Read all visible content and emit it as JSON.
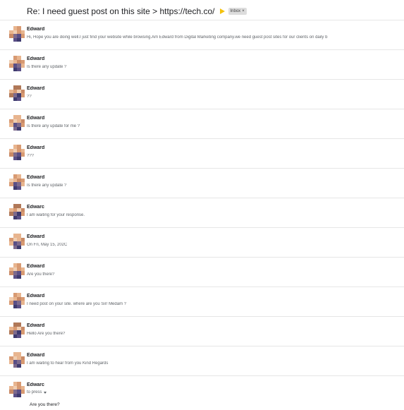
{
  "subject": "Re: I need guest post on this site > https://tech.co/",
  "label": {
    "text": "Inbox",
    "close": "×"
  },
  "messages": [
    {
      "sender": "Edward",
      "snippet": "Hi, Hope you are doing well.I just find your website while browsing.Am Edward from Digital Marketing company.we need guest post sites for our clients on daily b"
    },
    {
      "sender": "Edward",
      "snippet": "Is there any update ?"
    },
    {
      "sender": "Edward",
      "snippet": "??"
    },
    {
      "sender": "Edward",
      "snippet": "Is there any update for me ?"
    },
    {
      "sender": "Edward",
      "snippet": "???"
    },
    {
      "sender": "Edward",
      "snippet": "Is there any update ?"
    },
    {
      "sender": "Edwarc",
      "snippet": "I am waiting for your response."
    },
    {
      "sender": "Edward",
      "snippet": "On Fri, May 15, 202C"
    },
    {
      "sender": "Edward",
      "snippet": "Are you there?"
    },
    {
      "sender": "Edward",
      "snippet": "I need post on your site. where are you Sir/ Medam ?"
    },
    {
      "sender": "Edward",
      "snippet": "Hello Are you there?"
    },
    {
      "sender": "Edward",
      "snippet": "I am waiting to hear from you Kind Regards"
    }
  ],
  "last_message": {
    "sender": "Edwarc",
    "to": "to press",
    "body": "Are you there?"
  },
  "colors": {
    "avatar_palette": [
      "#e8b58f",
      "#d89a72",
      "#c98a66",
      "#f0cdb0",
      "#b07858",
      "#7d6a8c",
      "#5a4f86",
      "#3e3a6e",
      "#ffffff"
    ],
    "important": "#f4c20d"
  }
}
